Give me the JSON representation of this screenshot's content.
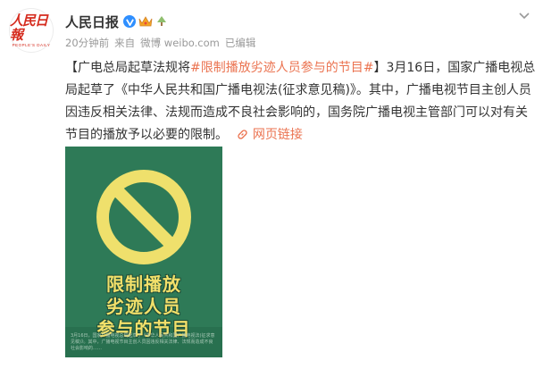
{
  "account": {
    "name": "人民日报",
    "logo_text": "人民日報",
    "logo_sub": "PEOPLE'S DAILY",
    "verified_icon": "verified-v-icon",
    "crown_icon": "crown-icon",
    "tree_icon": "tree-icon"
  },
  "meta": {
    "time": "20分钟前",
    "source_prefix": "来自",
    "source": "微博 weibo.com",
    "edited": "已编辑"
  },
  "post": {
    "bracket_open": "【广电总局起草法规将",
    "hashtag": "#限制播放劣迹人员参与的节目#",
    "bracket_close": "】",
    "body": "3月16日，国家广播电视总局起草了《中华人民共和国广播电视法(征求意见稿)》。其中，广播电视节目主创人员因违反相关法律、法规而造成不良社会影响的，国务院广播电视主管部门可以对有关节目的播放予以必要的限制。",
    "link_icon": "link-icon",
    "link_label": "网页链接"
  },
  "poster": {
    "line1": "限制播放",
    "line2": "劣迹人员",
    "line3": "参与的节目",
    "fine_print": "3月16日，国家广播电视总局起草了《中华人民共和国广播电视法(征求意见稿)》。其中，广播电视节目主创人员因违反相关法律、法规而造成不良社会影响的……",
    "colors": {
      "background": "#2e7a57",
      "symbol": "#efe06c",
      "text": "#f2e06a"
    }
  },
  "menu": {
    "chevron_icon": "chevron-down-icon"
  }
}
